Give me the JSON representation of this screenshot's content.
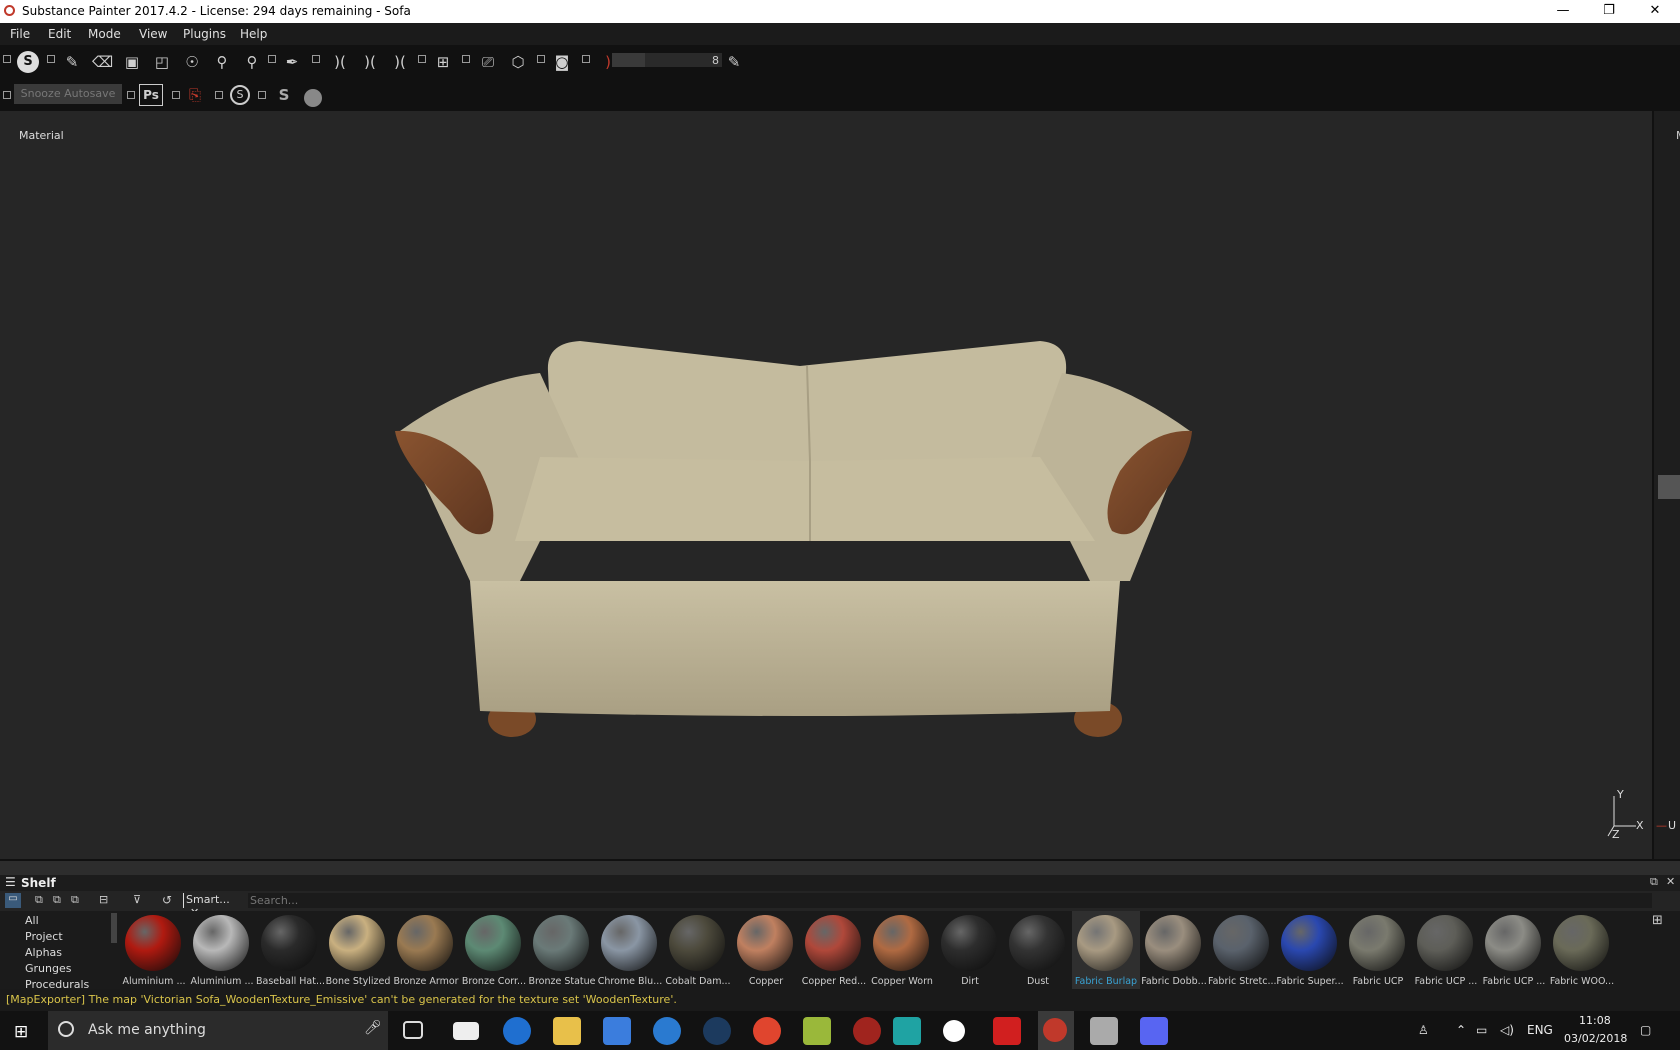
{
  "window": {
    "title": "Substance Painter 2017.4.2 - License: 294 days remaining - Sofa",
    "minimize": "—",
    "restore": "❐",
    "close": "✕"
  },
  "menu": [
    "File",
    "Edit",
    "Mode",
    "View",
    "Plugins",
    "Help"
  ],
  "toolbar": {
    "brush_size_value": "8",
    "brush_size_fraction": 0.3,
    "snooze_autosave": "Snooze Autosave"
  },
  "viewport": {
    "label": "Material",
    "right_label": "M",
    "axes": {
      "y": "Y",
      "x": "X",
      "z": "Z",
      "u": "U"
    }
  },
  "shelf": {
    "title": "Shelf",
    "filter_chip": "Smart...",
    "search_placeholder": "Search...",
    "categories": [
      "All",
      "Project",
      "Alphas",
      "Grunges",
      "Procedurals"
    ],
    "selected_material": "Fabric Burlap",
    "materials": [
      {
        "name": "Aluminium ...",
        "color": "#b01a10"
      },
      {
        "name": "Aluminium ...",
        "color": "#b8b8b8"
      },
      {
        "name": "Baseball Hat...",
        "color": "#2a2a2a"
      },
      {
        "name": "Bone Stylized",
        "color": "#c9b080"
      },
      {
        "name": "Bronze Armor",
        "color": "#9a7a52"
      },
      {
        "name": "Bronze Corr...",
        "color": "#5d8a74"
      },
      {
        "name": "Bronze Statue",
        "color": "#6a7a78"
      },
      {
        "name": "Chrome Blu...",
        "color": "#8a96a4"
      },
      {
        "name": "Cobalt Dam...",
        "color": "#4d4a3c"
      },
      {
        "name": "Copper",
        "color": "#c08060"
      },
      {
        "name": "Copper Red...",
        "color": "#b0483a"
      },
      {
        "name": "Copper Worn",
        "color": "#b06a42"
      },
      {
        "name": "Dirt",
        "color": "#2d2d2d"
      },
      {
        "name": "Dust",
        "color": "#333333"
      },
      {
        "name": "Fabric Burlap",
        "color": "#a89a82"
      },
      {
        "name": "Fabric Dobb...",
        "color": "#9a8e7e"
      },
      {
        "name": "Fabric Stretc...",
        "color": "#5a626c"
      },
      {
        "name": "Fabric Super...",
        "color": "#2a48b0"
      },
      {
        "name": "Fabric UCP",
        "color": "#7a7a6e"
      },
      {
        "name": "Fabric UCP ...",
        "color": "#5e5e58"
      },
      {
        "name": "Fabric UCP ...",
        "color": "#8c8c86"
      },
      {
        "name": "Fabric WOO...",
        "color": "#6a6a58"
      }
    ]
  },
  "status_message": "[MapExporter] The map 'Victorian Sofa_WoodenTexture_Emissive' can't be generated for the texture set 'WoodenTexture'.",
  "taskbar": {
    "search_placeholder": "Ask me anything",
    "language": "ENG",
    "time": "11:08",
    "date": "03/02/2018"
  },
  "colors": {
    "accent": "#3aa3d4",
    "status_text": "#d9c44a",
    "sofa_fabric": "#bfb597",
    "sofa_wood": "#7a4a28"
  }
}
